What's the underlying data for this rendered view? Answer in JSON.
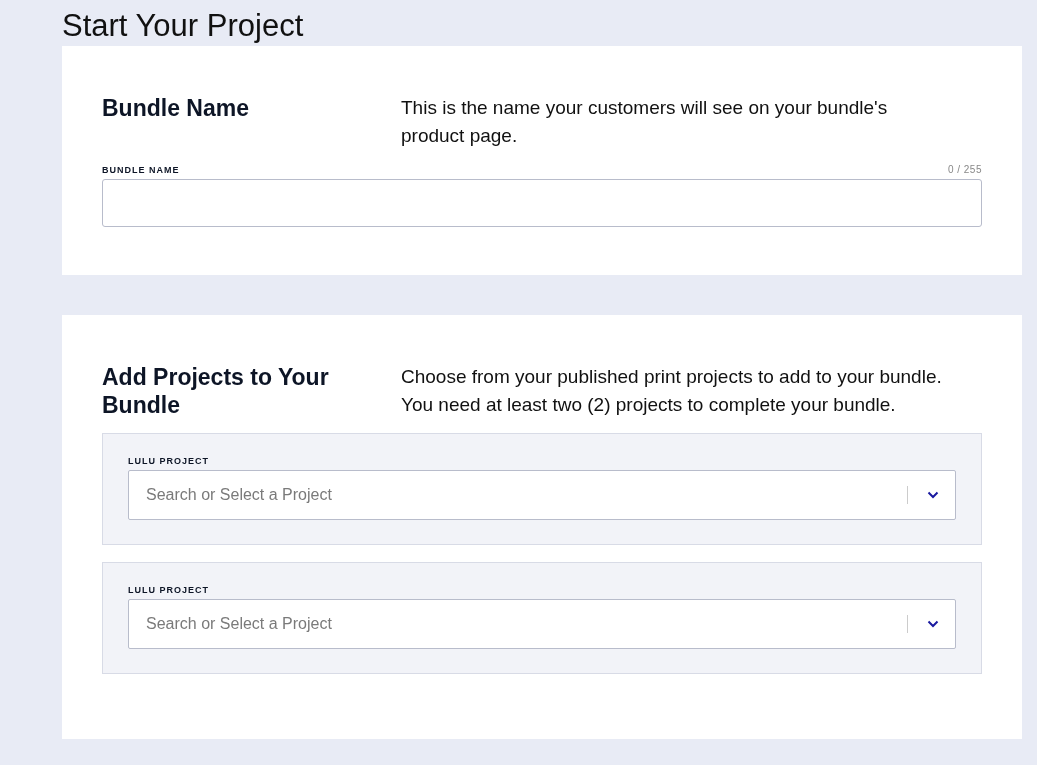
{
  "page": {
    "title": "Start Your Project"
  },
  "sections": [
    {
      "kind": "name",
      "heading": "Bundle Name",
      "description": "This is the name your customers will see on your bundle's product page.",
      "field": {
        "label": "BUNDLE NAME",
        "counter": "0 / 255"
      }
    },
    {
      "kind": "projects",
      "heading": "Add Projects to Your Bundle",
      "description": "Choose from your published print projects to add to your bundle. You need at least two (2) projects to complete your bundle.",
      "projects": [
        {
          "label": "LULU PROJECT",
          "placeholder": "Search or Select a Project"
        },
        {
          "label": "LULU PROJECT",
          "placeholder": "Search or Select a Project"
        }
      ]
    }
  ]
}
